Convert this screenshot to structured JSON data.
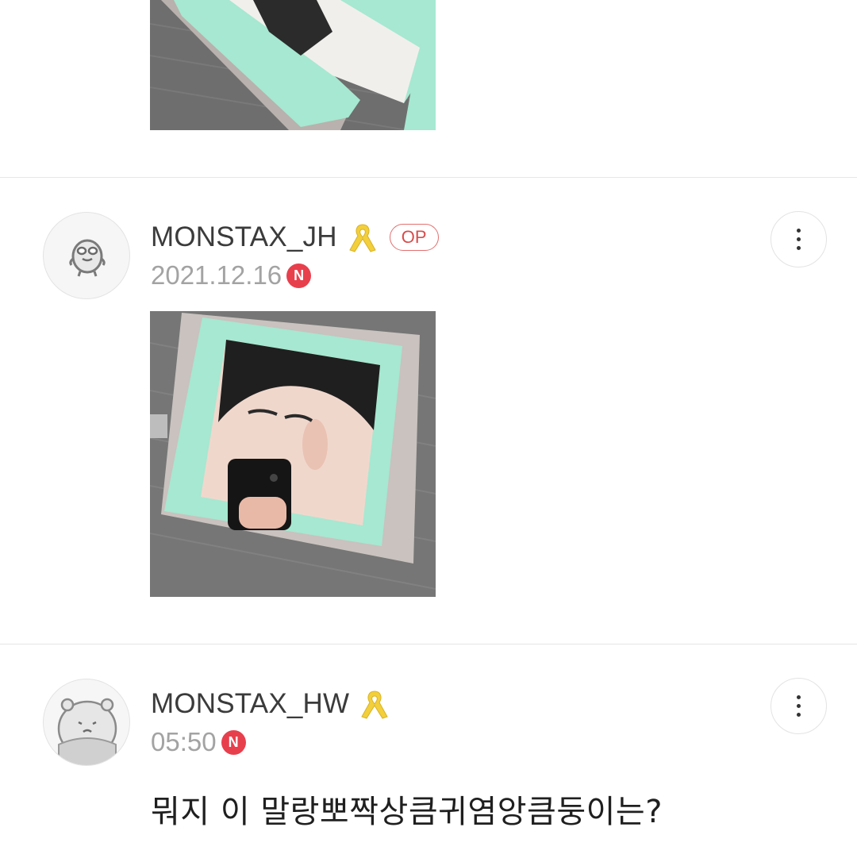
{
  "comments": [
    {
      "author": "MONSTAX_JH",
      "op_label": "OP",
      "date": "2021.12.16",
      "new_badge": "N",
      "avatar_icon": "grey-mascot-icon",
      "attachment": "photo"
    },
    {
      "author": "MONSTAX_HW",
      "date": "05:50",
      "new_badge": "N",
      "avatar_icon": "hamster-mascot-icon",
      "text": "뭐지 이 말랑뽀짝상큼귀염앙큼둥이는?"
    }
  ],
  "icons": {
    "ribbon": "yellow-ribbon-icon",
    "more": "more-vertical-icon"
  },
  "colors": {
    "accent_red": "#e83f4d",
    "op_border": "#e26f6f",
    "ribbon_yellow": "#f2cf3b",
    "frame_mint": "#a8e7d3"
  }
}
